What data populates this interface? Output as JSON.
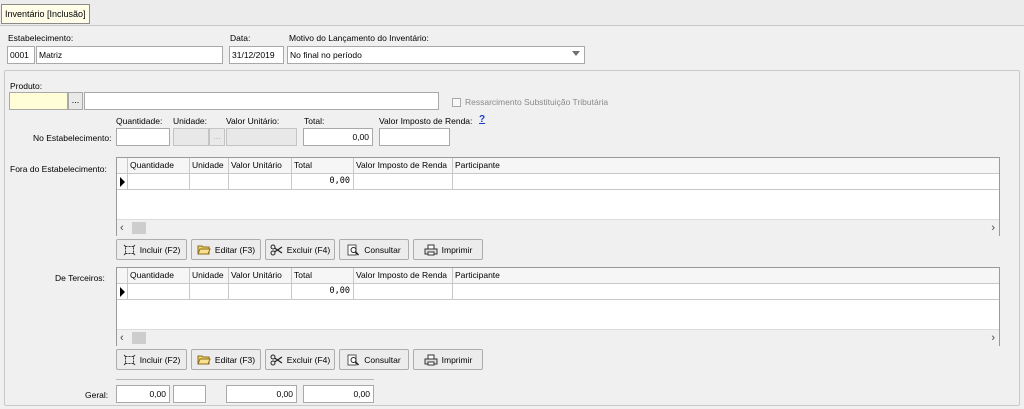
{
  "tab": {
    "label": "Inventário [Inclusão]"
  },
  "header": {
    "estabelecimento_label": "Estabelecimento:",
    "estabelecimento_code": "0001",
    "estabelecimento_name": "Matriz",
    "data_label": "Data:",
    "data_value": "31/12/2019",
    "motivo_label": "Motivo do Lançamento do Inventário:",
    "motivo_value": "No final no período"
  },
  "produto": {
    "label": "Produto:",
    "code": "",
    "lookup": "...",
    "description": "",
    "ressarcimento_label": "Ressarcimento Substituição Tributária"
  },
  "columns": {
    "quantidade": "Quantidade:",
    "unidade": "Unidade:",
    "valor_unitario": "Valor Unitário:",
    "total": "Total:",
    "valor_ir": "Valor Imposto de Renda:",
    "help": "?"
  },
  "no_estabelecimento": {
    "label": "No Estabelecimento:",
    "quantidade": "",
    "unidade": "",
    "lookup": "...",
    "valor_unitario": "",
    "total": "0,00",
    "valor_ir": ""
  },
  "fora": {
    "label": "Fora do Estabelecimento:",
    "headers": [
      "Quantidade",
      "Unidade",
      "Valor Unitário",
      "Total",
      "Valor Imposto de Renda",
      "Participante"
    ],
    "row": [
      "",
      "",
      "",
      "0,00",
      "",
      ""
    ]
  },
  "terceiros": {
    "label": "De Terceiros:",
    "headers": [
      "Quantidade",
      "Unidade",
      "Valor Unitário",
      "Total",
      "Valor Imposto de Renda",
      "Participante"
    ],
    "row": [
      "",
      "",
      "",
      "0,00",
      "",
      ""
    ]
  },
  "buttons": {
    "incluir": "Incluir (F2)",
    "editar": "Editar (F3)",
    "excluir": "Excluir (F4)",
    "consultar": "Consultar",
    "imprimir": "Imprimir"
  },
  "geral": {
    "label": "Geral:",
    "quantidade": "0,00",
    "unidade": "",
    "valor_unitario": "0,00",
    "total": "0,00"
  },
  "scroll": {
    "left": "‹",
    "right": "›"
  },
  "icons": [
    "tab-icon",
    "incluir-icon",
    "folder-icon",
    "scissors-icon",
    "magnifier-icon",
    "printer-icon",
    "chevron-down-icon",
    "row-indicator-icon"
  ]
}
